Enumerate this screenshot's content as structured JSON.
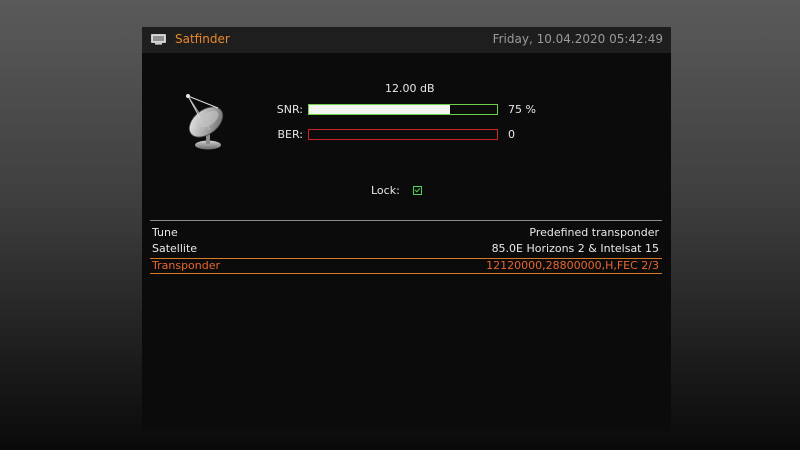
{
  "window": {
    "title": "Satfinder",
    "datetime": "Friday, 10.04.2020  05:42:49",
    "title_icon": "tv-icon",
    "accent_color": "#e9882a"
  },
  "signal": {
    "snr_db": "12.00 dB",
    "snr_label": "SNR:",
    "snr_percent_text": "75 %",
    "snr_level": 0.75,
    "snr_color": "#6fcf4a",
    "ber_label": "BER:",
    "ber_value": "0",
    "ber_level": 0,
    "ber_color": "#c9262b",
    "lock_label": "Lock:",
    "locked": true
  },
  "menu": [
    {
      "label": "Tune",
      "value": "Predefined transponder",
      "selected": false
    },
    {
      "label": "Satellite",
      "value": "85.0E Horizons 2 & Intelsat 15",
      "selected": false
    },
    {
      "label": "Transponder",
      "value": "12120000,28800000,H,FEC 2/3",
      "selected": true
    }
  ],
  "selection_color": "#e8662e"
}
